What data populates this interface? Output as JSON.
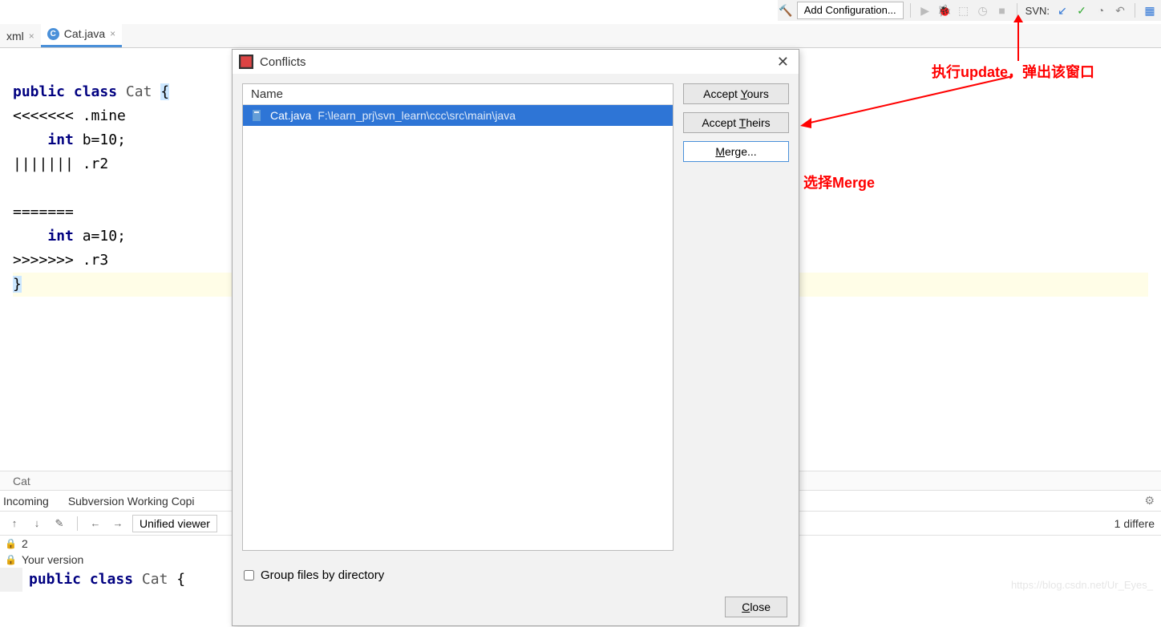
{
  "toolbar": {
    "add_config": "Add Configuration...",
    "svn_label": "SVN:"
  },
  "tabs": {
    "left_tab": "xml",
    "active_tab": "Cat.java"
  },
  "code_lines": {
    "l1a": "public",
    "l1b": "class",
    "l1c": "Cat",
    "l1d": "{",
    "l2": "<<<<<<< .mine",
    "l3a": "int",
    "l3b": "b=10;",
    "l4": "||||||| .r2",
    "l5": "",
    "l6": "=======",
    "l7a": "int",
    "l7b": "a=10;",
    "l8": ">>>>>>> .r3",
    "l9": "}"
  },
  "breadcrumb": {
    "item": "Cat"
  },
  "tool_tabs": {
    "incoming": "Incoming",
    "svn_wc": "Subversion Working Copi"
  },
  "diff_toolbar": {
    "viewer_mode": "Unified viewer",
    "diff_count": "1 differe"
  },
  "diff_panel": {
    "line_num": "2",
    "header": "Your version",
    "code_a": "public",
    "code_b": "class",
    "code_c": "Cat",
    "code_d": "{"
  },
  "dialog": {
    "title": "Conflicts",
    "list_header": "Name",
    "file_name": "Cat.java",
    "file_path": "F:\\learn_prj\\svn_learn\\ccc\\src\\main\\java",
    "btn_yours_pre": "Accept ",
    "btn_yours_u": "Y",
    "btn_yours_post": "ours",
    "btn_theirs_pre": "Accept ",
    "btn_theirs_u": "T",
    "btn_theirs_post": "heirs",
    "btn_merge_u": "M",
    "btn_merge_post": "erge...",
    "group_chk": "Group files by directory",
    "close_u": "C",
    "close_post": "lose"
  },
  "annotations": {
    "a1": "执行update，弹出该窗口",
    "a2": "选择Merge"
  },
  "watermark": "https://blog.csdn.net/Ur_Eyes_"
}
